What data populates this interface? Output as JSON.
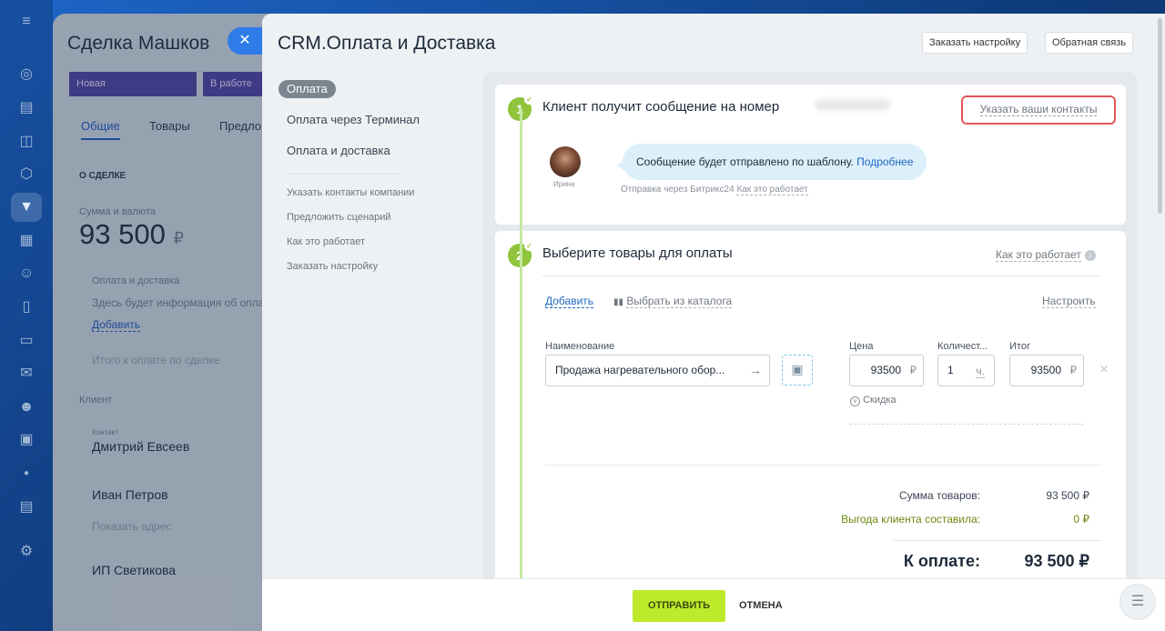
{
  "deal": {
    "title": "Сделка Машков",
    "stages": [
      "Новая",
      "В работе"
    ],
    "tabs": [
      "Общие",
      "Товары",
      "Предло"
    ],
    "section_label": "О СДЕЛКЕ",
    "amount_label": "Сумма и валюта",
    "amount": "93 500",
    "currency": "₽",
    "pay_block_title": "Оплата и доставка",
    "pay_block_text": "Здесь будет информация об опла",
    "pay_block_link": "Добавить",
    "total_label": "Итого к оплате по сделке",
    "client_label": "Клиент",
    "contact_label": "Контакт",
    "contact_name": "Дмитрий Евсеев",
    "second_name": "Иван Петров",
    "show_address": "Показать адрес",
    "company": "ИП Светикова"
  },
  "panel": {
    "title": "CRM.Оплата и Доставка",
    "order_setup_btn": "Заказать настройку",
    "feedback_btn": "Обратная связь"
  },
  "menu": {
    "active": "Оплата",
    "items": [
      "Оплата через Терминал",
      "Оплата и доставка"
    ],
    "small_items": [
      "Указать контакты компании",
      "Предложить сценарий",
      "Как это работает",
      "Заказать настройку"
    ]
  },
  "step1": {
    "number": "1",
    "title": "Клиент получит сообщение на номер",
    "contacts_btn": "Указать ваши контакты",
    "avatar_name": "Ирина",
    "bubble_text": "Сообщение будет отправлено по шаблону.",
    "bubble_link": "Подробнее",
    "via_text": "Отправка через Битрикс24",
    "via_link": "Как это работает"
  },
  "step2": {
    "number": "2",
    "title": "Выберите товары для оплаты",
    "how_link": "Как это работает",
    "add_link": "Добавить",
    "catalog_link": "Выбрать из каталога",
    "configure_link": "Настроить",
    "col_name": "Наименование",
    "col_price": "Цена",
    "col_qty": "Количест...",
    "col_total": "Итог",
    "product_name": "Продажа нагревательного обор...",
    "price": "93500",
    "qty": "1",
    "unit": "ч.",
    "total": "93500",
    "currency": "₽",
    "discount_link": "Скидка",
    "goods_sum_label": "Сумма товаров:",
    "goods_sum_value": "93 500 ₽",
    "benefit_label": "Выгода клиента составила:",
    "benefit_value": "0 ₽",
    "to_pay_label": "К оплате:",
    "to_pay_value": "93 500 ₽"
  },
  "footer": {
    "send_btn": "ОТПРАВИТЬ",
    "cancel_btn": "ОТМЕНА"
  },
  "colors": {
    "accent_green": "#bdea2a",
    "step_green": "#8fc43c",
    "link_blue": "#1f67c0",
    "highlight_red": "#e2575a"
  }
}
